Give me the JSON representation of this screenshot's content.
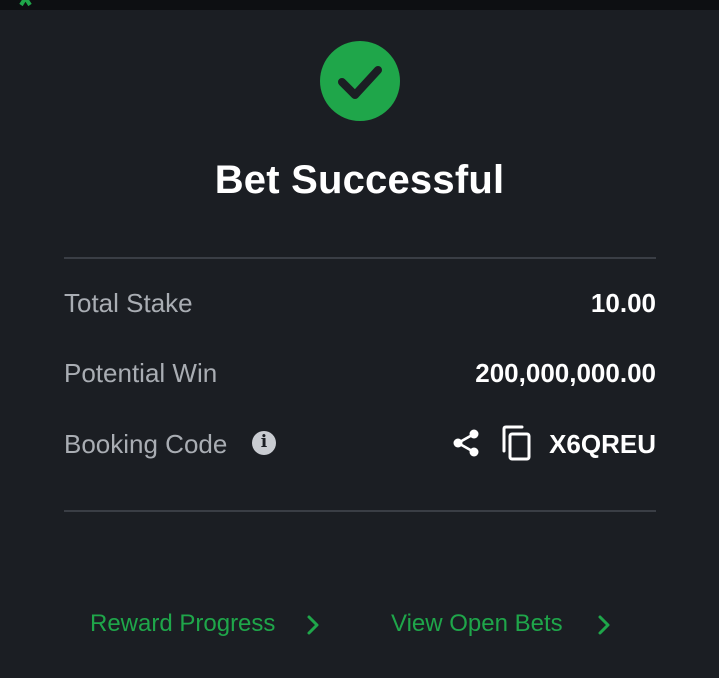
{
  "colors": {
    "background": "#1b1e23",
    "accent_green": "#1fa64a",
    "label_gray": "#a9adb3",
    "value_white": "#ffffff",
    "divider": "#3a3e45"
  },
  "status": {
    "icon": "check-circle-icon",
    "title": "Bet Successful"
  },
  "summary": {
    "total_stake": {
      "label": "Total Stake",
      "value": "10.00"
    },
    "potential_win": {
      "label": "Potential Win",
      "value": "200,000,000.00"
    },
    "booking_code": {
      "label": "Booking Code",
      "value": "X6QREU",
      "info_icon": "info-icon",
      "share_icon": "share-icon",
      "copy_icon": "copy-icon"
    }
  },
  "links": {
    "reward_progress": {
      "label": "Reward Progress",
      "icon": "chevron-right-icon"
    },
    "view_open_bets": {
      "label": "View Open Bets",
      "icon": "chevron-right-icon"
    }
  }
}
